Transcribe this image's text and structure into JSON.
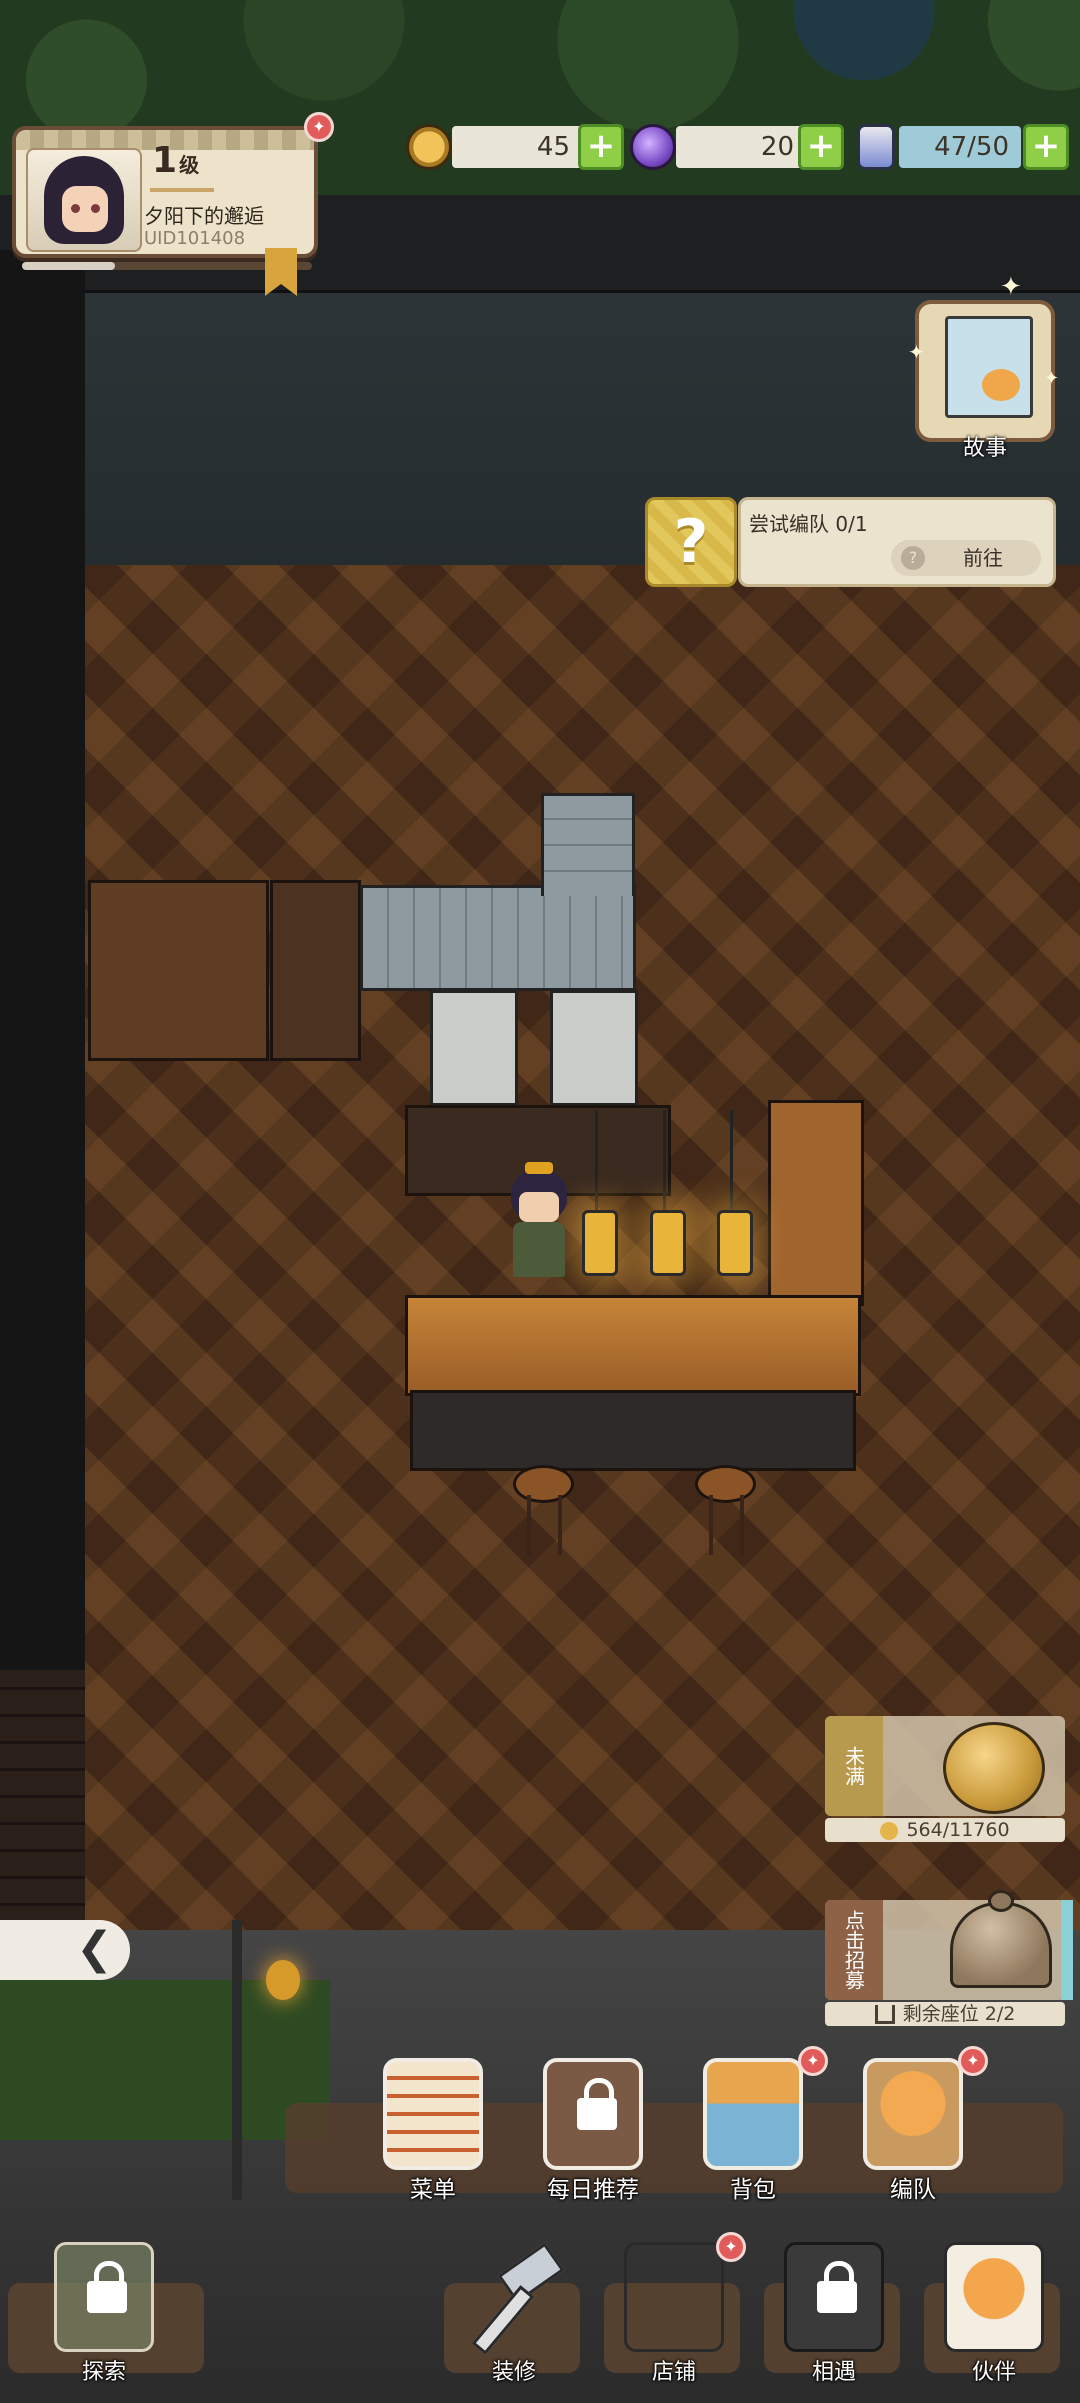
{
  "player": {
    "level": "1",
    "level_unit": "级",
    "name": "夕阳下的邂逅",
    "uid": "UID101408",
    "xp_fraction": 0.32
  },
  "currencies": [
    {
      "icon": "coin-icon",
      "value": "45",
      "color": "#e9e5d8"
    },
    {
      "icon": "purple-gem-icon",
      "value": "20",
      "color": "#e9e5d8"
    },
    {
      "icon": "potion-bottle-icon",
      "value": "47/50",
      "color": "#9fcbd9"
    }
  ],
  "story": {
    "label": "故事"
  },
  "quest": {
    "title": "尝试编队 0/1",
    "button": "前往",
    "help_glyph": "?",
    "icon_glyph": "?"
  },
  "savings": {
    "tag": "未满",
    "progress": "564/11760"
  },
  "recruit": {
    "tag": "点击招募",
    "seats": "剩余座位 2/2"
  },
  "back_glyph": "❮",
  "actions": [
    {
      "label": "菜单"
    },
    {
      "label": "每日推荐"
    },
    {
      "label": "背包"
    },
    {
      "label": "编队"
    }
  ],
  "nav": [
    {
      "label": "探索"
    },
    {
      "label": "装修"
    },
    {
      "label": "店铺"
    },
    {
      "label": "相遇"
    },
    {
      "label": "伙伴"
    }
  ],
  "badge_glyph": "✦"
}
